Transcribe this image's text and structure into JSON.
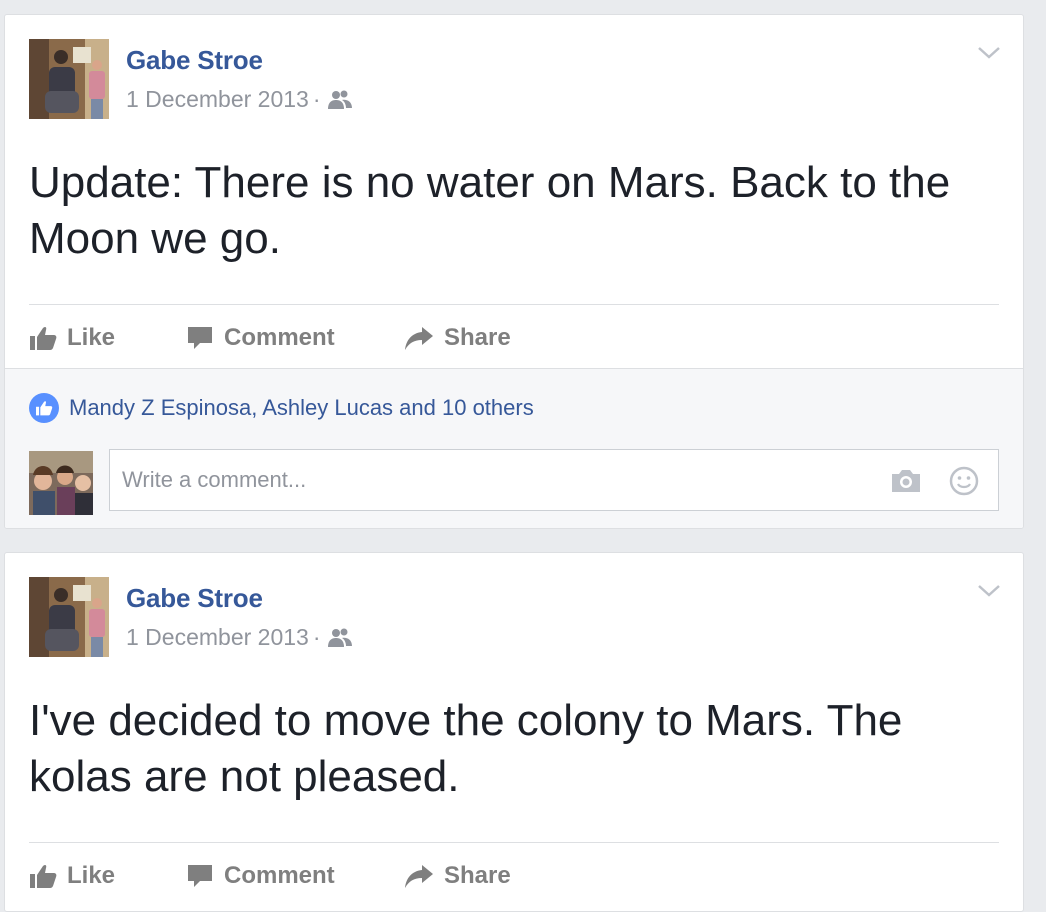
{
  "posts": [
    {
      "author": "Gabe Stroe",
      "date": "1 December 2013",
      "separator": "·",
      "audience_icon": "friends-icon",
      "text": "Update: There is no water on Mars. Back to the Moon we go.",
      "actions": {
        "like": "Like",
        "comment": "Comment",
        "share": "Share"
      },
      "likes_summary": "Mandy Z Espinosa, Ashley Lucas and 10 others",
      "comment_placeholder": "Write a comment..."
    },
    {
      "author": "Gabe Stroe",
      "date": "1 December 2013",
      "separator": "·",
      "audience_icon": "friends-icon",
      "text": "I've decided to move the colony to Mars. The kolas are not pleased.",
      "actions": {
        "like": "Like",
        "comment": "Comment",
        "share": "Share"
      }
    }
  ],
  "colors": {
    "page_bg": "#e9ebee",
    "link_blue": "#365899",
    "meta_gray": "#90949c",
    "action_gray": "#7f7f7f",
    "like_badge_blue": "#5890ff"
  }
}
